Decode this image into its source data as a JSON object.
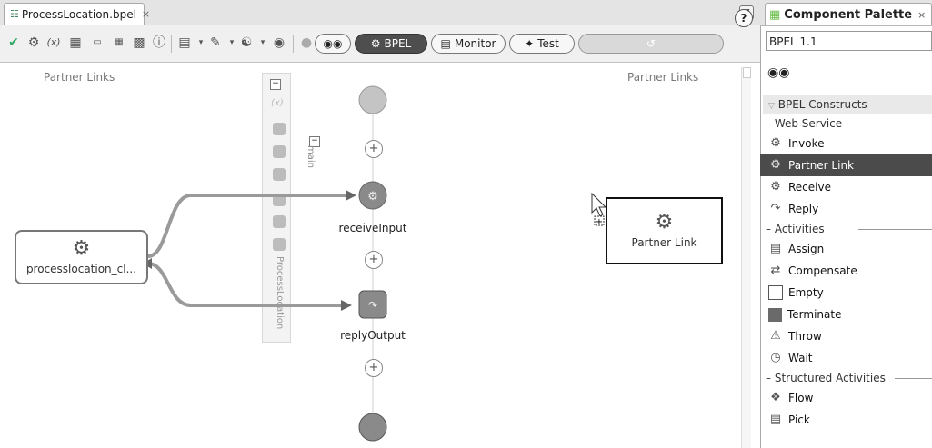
{
  "editor_tab": {
    "title": "ProcessLocation.bpel",
    "close": "×"
  },
  "toolbar": {
    "bpel_label": "BPEL",
    "monitor_label": "Monitor",
    "test_label": "Test",
    "help": "?"
  },
  "canvas": {
    "left_header": "Partner Links",
    "right_header": "Partner Links",
    "scope_label": "ProcessLocation",
    "main_label": "main",
    "left_partner_name": "processlocation_cl...",
    "right_partner_name": "Partner Link",
    "receive_label": "receiveInput",
    "reply_label": "replyOutput"
  },
  "palette": {
    "title": "Component Palette",
    "close": "×",
    "selected_library": "BPEL 1.1",
    "section": "BPEL Constructs",
    "groups": [
      {
        "label": "Web Service",
        "items": [
          {
            "label": "Invoke",
            "icon": "invoke-icon"
          },
          {
            "label": "Partner Link",
            "icon": "partner-link-icon",
            "selected": true
          },
          {
            "label": "Receive",
            "icon": "receive-icon"
          },
          {
            "label": "Reply",
            "icon": "reply-icon"
          }
        ]
      },
      {
        "label": "Activities",
        "items": [
          {
            "label": "Assign",
            "icon": "assign-icon"
          },
          {
            "label": "Compensate",
            "icon": "compensate-icon"
          },
          {
            "label": "Empty",
            "icon": "empty-icon"
          },
          {
            "label": "Terminate",
            "icon": "terminate-icon"
          },
          {
            "label": "Throw",
            "icon": "throw-icon"
          },
          {
            "label": "Wait",
            "icon": "wait-icon"
          }
        ]
      },
      {
        "label": "Structured Activities",
        "items": [
          {
            "label": "Flow",
            "icon": "flow-icon"
          },
          {
            "label": "Pick",
            "icon": "pick-icon"
          }
        ]
      }
    ]
  }
}
